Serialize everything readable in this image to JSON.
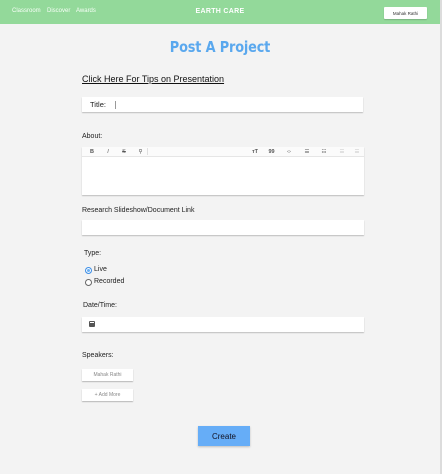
{
  "header": {
    "nav": [
      "Classroom",
      "Discover",
      "Awards"
    ],
    "brand": "EARTH CARE",
    "user_button": "Mahak Rathi"
  },
  "page": {
    "title": "Post A Project",
    "tips_link": "Click Here For Tips on Presentation"
  },
  "form": {
    "title_label": "Title:",
    "about_label": "About:",
    "about_toolbar": [
      "bold-icon",
      "italic-icon",
      "strikethrough-icon",
      "link-icon",
      "text-size-icon",
      "quote-icon",
      "code-icon",
      "bulleted-list-icon",
      "numbered-list-icon",
      "outdent-icon",
      "indent-icon"
    ],
    "research_label": "Research Slideshow/Document Link",
    "type_label": "Type:",
    "type_options": [
      {
        "label": "Live",
        "selected": true
      },
      {
        "label": "Recorded",
        "selected": false
      }
    ],
    "datetime_label": "Date/Time:",
    "speakers_label": "Speakers:",
    "speaker_chip": "Mahak Rathi",
    "add_more": "+ Add More",
    "create_button": "Create"
  },
  "colors": {
    "header_green": "#93d99a",
    "title_blue": "#5aa8ee",
    "create_blue": "#66adf7"
  }
}
